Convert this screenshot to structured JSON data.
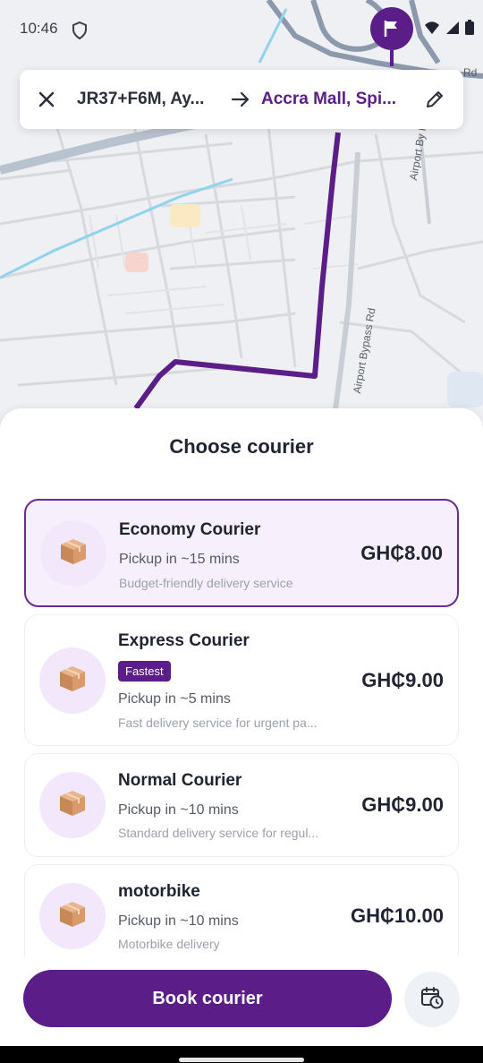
{
  "status_bar": {
    "time": "10:46",
    "icons": [
      "shield-icon",
      "wifi-icon",
      "signal-icon",
      "battery-icon"
    ]
  },
  "map": {
    "road_labels": [
      "Airport By Pass Rd",
      "Airport Bypass Rd",
      "Rd"
    ],
    "route_color": "#5b1d87",
    "destination_marker_icon": "flag-icon"
  },
  "route_bar": {
    "origin": "JR37+F6M, Ay...",
    "destination": "Accra Mall, Spi...",
    "icons": [
      "close-icon",
      "arrow-right-icon",
      "pencil-icon"
    ]
  },
  "sheet": {
    "title": "Choose courier",
    "couriers": [
      {
        "name": "Economy Courier",
        "badge": "",
        "pickup": "Pickup in ~15 mins",
        "description": "Budget-friendly delivery service",
        "price": "GH₵8.00",
        "selected": true,
        "icon": "package-icon"
      },
      {
        "name": "Express Courier",
        "badge": "Fastest",
        "pickup": "Pickup in ~5 mins",
        "description": "Fast delivery service for urgent pa...",
        "price": "GH₵9.00",
        "selected": false,
        "icon": "package-icon"
      },
      {
        "name": "Normal Courier",
        "badge": "",
        "pickup": "Pickup in ~10 mins",
        "description": "Standard delivery service for regul...",
        "price": "GH₵9.00",
        "selected": false,
        "icon": "package-icon"
      },
      {
        "name": "motorbike",
        "badge": "",
        "pickup": "Pickup in ~10 mins",
        "description": "Motorbike delivery",
        "price": "GH₵10.00",
        "selected": false,
        "icon": "package-icon"
      }
    ]
  },
  "footer": {
    "book_label": "Book courier",
    "schedule_icon": "calendar-clock-icon"
  },
  "colors": {
    "accent": "#5b1d87",
    "selected_card_bg": "#f7f0fc",
    "icon_circle_bg": "#f3e8fb"
  }
}
